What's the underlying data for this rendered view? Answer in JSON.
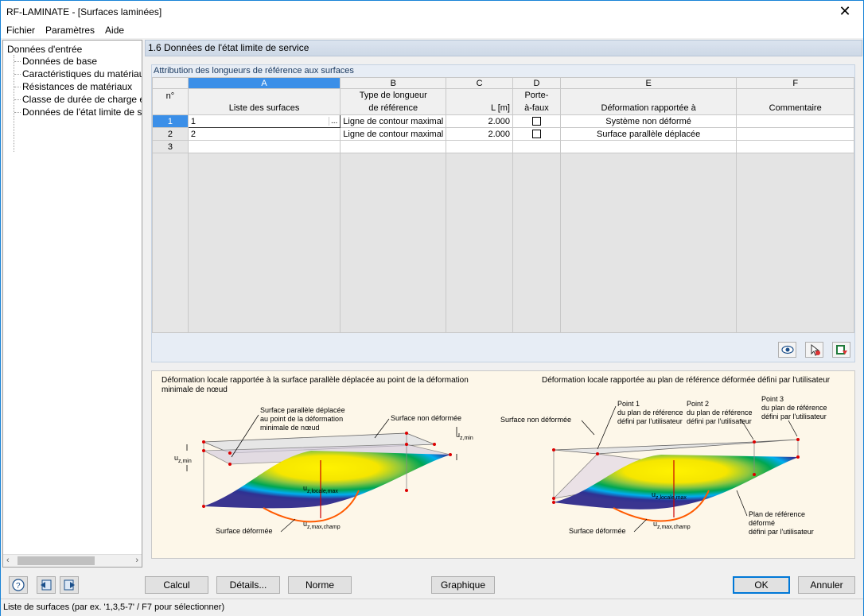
{
  "window": {
    "title": "RF-LAMINATE - [Surfaces laminées]",
    "close_symbol": "✕"
  },
  "menu": [
    "Fichier",
    "Paramètres",
    "Aide"
  ],
  "tree": {
    "root": "Données d'entrée",
    "items": [
      "Données de base",
      "Caractéristiques du matériau",
      "Résistances de matériaux",
      "Classe de durée de charge et c",
      "Données de l'état limite de serv"
    ]
  },
  "section_title": "1.6 Données de l'état limite de service",
  "panel_title": "Attribution des longueurs de référence aux surfaces",
  "table": {
    "col_letters": [
      "A",
      "B",
      "C",
      "D",
      "E",
      "F"
    ],
    "row_header": "n°",
    "headers_row1": {
      "B": "Type de longueur",
      "D": "Porte-"
    },
    "headers_row2": {
      "A": "Liste des surfaces",
      "B": "de référence",
      "C": "L [m]",
      "D": "à-faux",
      "E": "Déformation rapportée à",
      "F": "Commentaire"
    },
    "rows": [
      {
        "n": "1",
        "surfaces": "1",
        "type": "Ligne de contour maximal",
        "L": "2.000",
        "cantilever": false,
        "deformation": "Système non déformé",
        "comment": ""
      },
      {
        "n": "2",
        "surfaces": "2",
        "type": "Ligne de contour maximal",
        "L": "2.000",
        "cantilever": false,
        "deformation": "Surface parallèle déplacée",
        "comment": ""
      },
      {
        "n": "3",
        "surfaces": "",
        "type": "",
        "L": "",
        "cantilever": false,
        "deformation": "",
        "comment": ""
      }
    ],
    "ellipsis": "..."
  },
  "table_icons": [
    "eye-icon",
    "pick-icon",
    "export-icon"
  ],
  "illustration": {
    "left_title": "Déformation locale rapportée à la surface parallèle déplacée au point de la déformation minimale de nœud",
    "right_title": "Déformation locale rapportée au plan de référence déformée défini par l'utilisateur",
    "left_labels": {
      "parallel": [
        "Surface parallèle déplacée",
        "au point de la déformation",
        "minimale de nœud"
      ],
      "undeformed": "Surface non déformée",
      "deformed": "Surface déformée",
      "uzmin": "u",
      "uzmin_sub": "z,min",
      "uzloc": "u",
      "uzloc_sub": "z,locale,max",
      "uzmax": "u",
      "uzmax_sub": "z,max,champ"
    },
    "right_labels": {
      "undeformed": "Surface non déformée",
      "p1": [
        "Point 1",
        "du plan de référence",
        "défini par l'utilisateur"
      ],
      "p2": [
        "Point 2",
        "du plan de référence",
        "défini par l'utilisateur"
      ],
      "p3": [
        "Point 3",
        "du plan de référence",
        "défini par l'utilisateur"
      ],
      "plane": [
        "Plan de référence",
        "déformé",
        "défini par l'utilisateur"
      ],
      "deformed": "Surface déformée",
      "uzloc": "u",
      "uzloc_sub": "z,locale,max",
      "uzmax": "u",
      "uzmax_sub": "z,max,champ"
    }
  },
  "buttons": {
    "calc": "Calcul",
    "details": "Détails...",
    "norm": "Norme",
    "graphic": "Graphique",
    "ok": "OK",
    "cancel": "Annuler"
  },
  "status": "Liste de surfaces (par ex. '1,3,5-7' / F7 pour sélectionner)"
}
